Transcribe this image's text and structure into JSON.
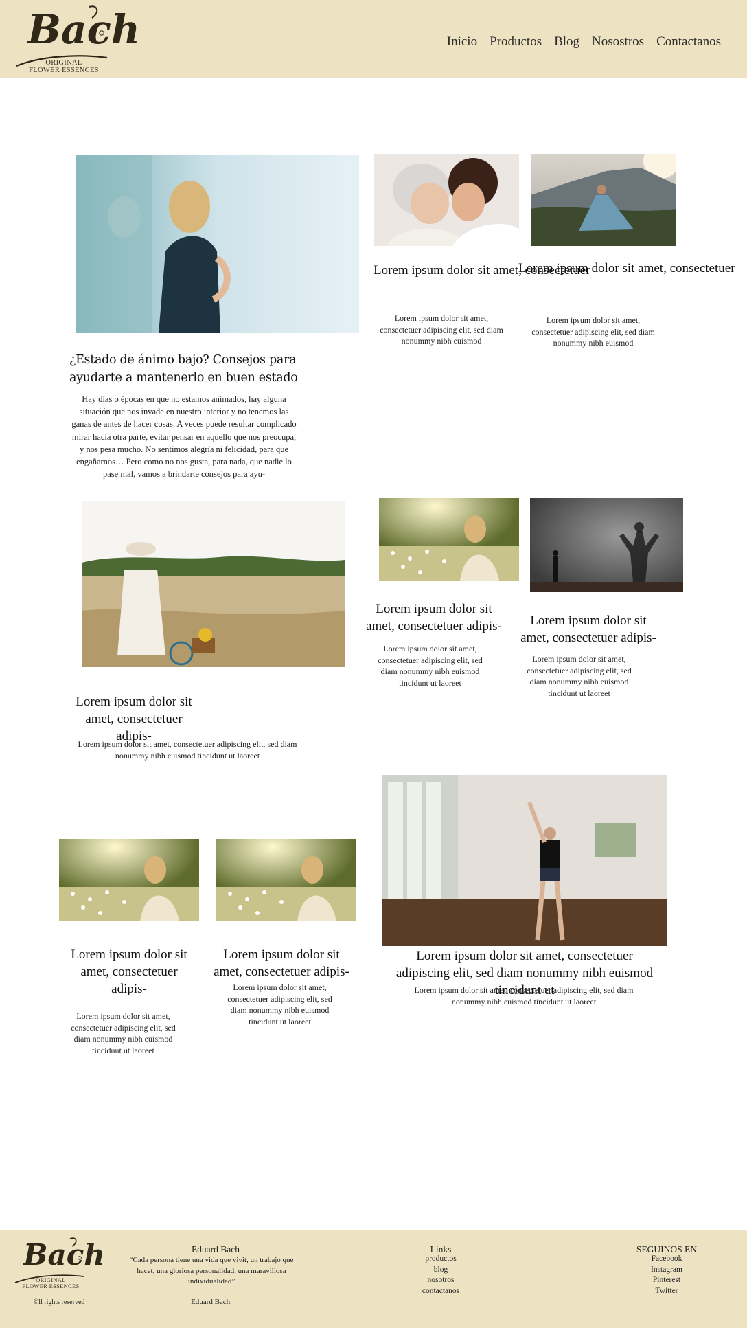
{
  "header": {
    "logo_script": "Bach",
    "logo_line1": "ORIGINAL",
    "logo_line2": "FLOWER ESSENCES",
    "nav": [
      {
        "label": "Inicio"
      },
      {
        "label": "Productos"
      },
      {
        "label": "Blog"
      },
      {
        "label": "Nosostros"
      },
      {
        "label": "Contactanos"
      }
    ]
  },
  "featured": {
    "title_line1": "¿Estado de ánimo bajo? Consejos para",
    "title_line2": "ayudarte a mantenerlo en buen estado",
    "body": "Hay días o épocas en que no estamos animados, hay alguna situación que nos invade en nuestro interior y no tenemos las ganas de antes de hacer cosas. A veces puede resultar complicado mirar hacia otra parte, evitar pensar en aquello que nos preocupa, y nos pesa mucho. No sentimos alegría ni felicidad, para que engañarnos… Pero como no nos gusta, para nada, que nadie lo pase mal, vamos a brindarte consejos para ayu-"
  },
  "posts": [
    {
      "title": "Lorem ipsum dolor sit amet, consectetuer",
      "excerpt": "Lorem ipsum dolor sit amet, consectetuer adipiscing elit, sed diam nonummy nibh euismod"
    },
    {
      "title": "Lorem ipsum dolor sit amet, consectetuer",
      "excerpt": "Lorem ipsum dolor sit amet, consectetuer adipiscing elit, sed diam nonummy nibh euismod"
    },
    {
      "title": "Lorem ipsum dolor sit amet, consectetuer adipis-",
      "excerpt": "Lorem ipsum dolor sit amet, consectetuer adipiscing elit, sed diam nonummy nibh euismod tincidunt ut laoreet"
    },
    {
      "title": "Lorem ipsum dolor sit amet, consectetuer adipis-",
      "excerpt": "Lorem ipsum dolor sit amet, consectetuer adipiscing elit, sed diam nonummy nibh euismod tincidunt ut laoreet"
    },
    {
      "title": "Lorem ipsum dolor sit amet, consectetuer adipis-",
      "excerpt": "Lorem ipsum dolor sit amet, consectetuer adipiscing elit, sed diam nonummy nibh euismod tincidunt ut laoreet"
    },
    {
      "title": "Lorem ipsum dolor sit amet, consectetuer adipis-",
      "excerpt": "Lorem ipsum dolor sit amet, consectetuer adipiscing elit, sed diam nonummy nibh euismod tincidunt ut laoreet"
    },
    {
      "title": "Lorem ipsum dolor sit amet, consectetuer adipis-",
      "excerpt": "Lorem ipsum dolor sit amet, consectetuer adipiscing elit, sed diam nonummy nibh euismod tincidunt ut laoreet"
    },
    {
      "title": "Lorem ipsum dolor sit amet, consectetuer adipiscing elit, sed diam nonummy nibh euismod tincidunt ut",
      "excerpt": "Lorem ipsum dolor sit amet, consectetuer adipiscing elit, sed diam nonummy nibh euismod tincidunt ut laoreet"
    }
  ],
  "footer": {
    "rights": "©ll rights reserved",
    "about_heading": "Eduard Bach",
    "quote": "“Cada persona tiene una vida que vivit, un trabajo que hacet, una gloriosa personalidad, una maravillosa individualidad”",
    "quote_author": "Eduard Bach.",
    "links_heading": "Links",
    "links": [
      "productos",
      "blog",
      "nosotros",
      "contactanos"
    ],
    "social_heading": "SEGUINOS EN",
    "social": [
      "Facebook",
      "Instagram",
      "Pinterest",
      "Twitter"
    ]
  },
  "colors": {
    "header_bg": "#ede3c3",
    "footer_bg": "#ede3c3",
    "text": "#1b1b1b"
  }
}
